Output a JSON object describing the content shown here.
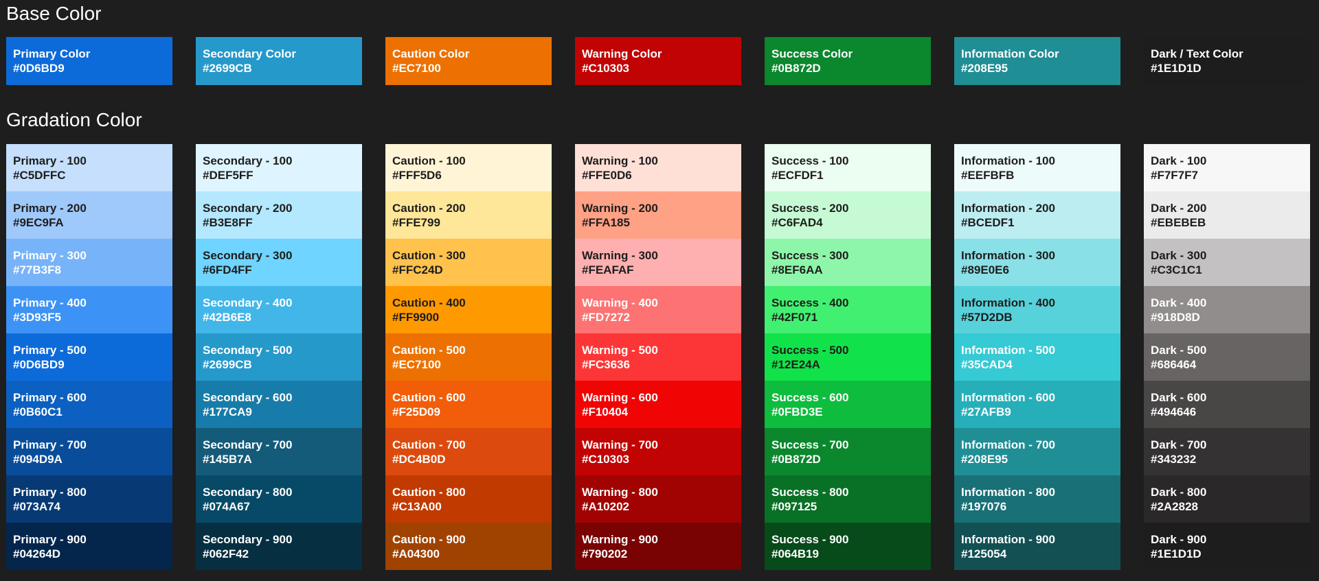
{
  "base": {
    "title": "Base Color",
    "swatches": [
      {
        "name": "Primary Color",
        "hex": "#0D6BD9",
        "bg": "#0D6BD9",
        "fg": "#ffffff"
      },
      {
        "name": "Secondary Color",
        "hex": "#2699CB",
        "bg": "#2699CB",
        "fg": "#ffffff"
      },
      {
        "name": "Caution Color",
        "hex": "#EC7100",
        "bg": "#EC7100",
        "fg": "#ffffff"
      },
      {
        "name": "Warning Color",
        "hex": "#C10303",
        "bg": "#C10303",
        "fg": "#ffffff"
      },
      {
        "name": "Success Color",
        "hex": "#0B872D",
        "bg": "#0B872D",
        "fg": "#ffffff"
      },
      {
        "name": "Information Color",
        "hex": "#208E95",
        "bg": "#208E95",
        "fg": "#ffffff"
      },
      {
        "name": "Dark / Text Color",
        "hex": "#1E1D1D",
        "bg": "#1E1D1D",
        "fg": "#ffffff"
      }
    ]
  },
  "gradation": {
    "title": "Gradation Color",
    "groups": [
      {
        "key": "primary",
        "cells": [
          {
            "label": "Primary - 100",
            "hex": "#C5DFFC",
            "fg": "#1e1d1d"
          },
          {
            "label": "Primary - 200",
            "hex": "#9EC9FA",
            "fg": "#1e1d1d"
          },
          {
            "label": "Primary - 300",
            "hex": "#77B3F8",
            "fg": "#ffffff"
          },
          {
            "label": "Primary - 400",
            "hex": "#3D93F5",
            "fg": "#ffffff"
          },
          {
            "label": "Primary - 500",
            "hex": "#0D6BD9",
            "fg": "#ffffff"
          },
          {
            "label": "Primary - 600",
            "hex": "#0B60C1",
            "fg": "#ffffff"
          },
          {
            "label": "Primary - 700",
            "hex": "#094D9A",
            "fg": "#ffffff"
          },
          {
            "label": "Primary - 800",
            "hex": "#073A74",
            "fg": "#ffffff"
          },
          {
            "label": "Primary - 900",
            "hex": "#04264D",
            "fg": "#ffffff"
          }
        ]
      },
      {
        "key": "secondary",
        "cells": [
          {
            "label": "Secondary - 100",
            "hex": "#DEF5FF",
            "fg": "#1e1d1d"
          },
          {
            "label": "Secondary - 200",
            "hex": "#B3E8FF",
            "fg": "#1e1d1d"
          },
          {
            "label": "Secondary - 300",
            "hex": "#6FD4FF",
            "fg": "#1e1d1d"
          },
          {
            "label": "Secondary - 400",
            "hex": "#42B6E8",
            "fg": "#ffffff"
          },
          {
            "label": "Secondary - 500",
            "hex": "#2699CB",
            "fg": "#ffffff"
          },
          {
            "label": "Secondary - 600",
            "hex": "#177CA9",
            "fg": "#ffffff"
          },
          {
            "label": "Secondary - 700",
            "hex": "#145B7A",
            "fg": "#ffffff"
          },
          {
            "label": "Secondary - 800",
            "hex": "#074A67",
            "fg": "#ffffff"
          },
          {
            "label": "Secondary - 900",
            "hex": "#062F42",
            "fg": "#ffffff"
          }
        ]
      },
      {
        "key": "caution",
        "cells": [
          {
            "label": "Caution - 100",
            "hex": "#FFF5D6",
            "fg": "#1e1d1d"
          },
          {
            "label": "Caution - 200",
            "hex": "#FFE799",
            "fg": "#1e1d1d"
          },
          {
            "label": "Caution - 300",
            "hex": "#FFC24D",
            "fg": "#1e1d1d"
          },
          {
            "label": "Caution - 400",
            "hex": "#FF9900",
            "fg": "#1e1d1d"
          },
          {
            "label": "Caution - 500",
            "hex": "#EC7100",
            "fg": "#ffffff"
          },
          {
            "label": "Caution - 600",
            "hex": "#F25D09",
            "fg": "#ffffff"
          },
          {
            "label": "Caution - 700",
            "hex": "#DC4B0D",
            "fg": "#ffffff"
          },
          {
            "label": "Caution - 800",
            "hex": "#C13A00",
            "fg": "#ffffff"
          },
          {
            "label": "Caution - 900",
            "hex": "#A04300",
            "fg": "#ffffff"
          }
        ]
      },
      {
        "key": "warning",
        "cells": [
          {
            "label": "Warning - 100",
            "hex": "#FFE0D6",
            "fg": "#1e1d1d"
          },
          {
            "label": "Warning - 200",
            "hex": "#FFA185",
            "fg": "#1e1d1d"
          },
          {
            "label": "Warning - 300",
            "hex": "#FEAFAF",
            "fg": "#1e1d1d"
          },
          {
            "label": "Warning - 400",
            "hex": "#FD7272",
            "fg": "#ffffff"
          },
          {
            "label": "Warning - 500",
            "hex": "#FC3636",
            "fg": "#ffffff"
          },
          {
            "label": "Warning - 600",
            "hex": "#F10404",
            "fg": "#ffffff"
          },
          {
            "label": "Warning - 700",
            "hex": "#C10303",
            "fg": "#ffffff"
          },
          {
            "label": "Warning - 800",
            "hex": "#A10202",
            "fg": "#ffffff"
          },
          {
            "label": "Warning - 900",
            "hex": "#790202",
            "fg": "#ffffff"
          }
        ]
      },
      {
        "key": "success",
        "cells": [
          {
            "label": "Success - 100",
            "hex": "#ECFDF1",
            "fg": "#1e1d1d"
          },
          {
            "label": "Success - 200",
            "hex": "#C6FAD4",
            "fg": "#1e1d1d"
          },
          {
            "label": "Success - 300",
            "hex": "#8EF6AA",
            "fg": "#1e1d1d"
          },
          {
            "label": "Success - 400",
            "hex": "#42F071",
            "fg": "#1e1d1d"
          },
          {
            "label": "Success - 500",
            "hex": "#12E24A",
            "fg": "#1e1d1d"
          },
          {
            "label": "Success - 600",
            "hex": "#0FBD3E",
            "fg": "#ffffff"
          },
          {
            "label": "Success - 700",
            "hex": "#0B872D",
            "fg": "#ffffff"
          },
          {
            "label": "Success - 800",
            "hex": "#097125",
            "fg": "#ffffff"
          },
          {
            "label": "Success - 900",
            "hex": "#064B19",
            "fg": "#ffffff"
          }
        ]
      },
      {
        "key": "information",
        "cells": [
          {
            "label": "Information - 100",
            "hex": "#EEFBFB",
            "fg": "#1e1d1d"
          },
          {
            "label": "Information - 200",
            "hex": "#BCEDF1",
            "fg": "#1e1d1d"
          },
          {
            "label": "Information - 300",
            "hex": "#89E0E6",
            "fg": "#1e1d1d"
          },
          {
            "label": "Information - 400",
            "hex": "#57D2DB",
            "fg": "#1e1d1d"
          },
          {
            "label": "Information - 500",
            "hex": "#35CAD4",
            "fg": "#ffffff"
          },
          {
            "label": "Information - 600",
            "hex": "#27AFB9",
            "fg": "#ffffff"
          },
          {
            "label": "Information - 700",
            "hex": "#208E95",
            "fg": "#ffffff"
          },
          {
            "label": "Information - 800",
            "hex": "#197076",
            "fg": "#ffffff"
          },
          {
            "label": "Information - 900",
            "hex": "#125054",
            "fg": "#ffffff"
          }
        ]
      },
      {
        "key": "dark",
        "cells": [
          {
            "label": "Dark - 100",
            "hex": "#F7F7F7",
            "fg": "#1e1d1d"
          },
          {
            "label": "Dark - 200",
            "hex": "#EBEBEB",
            "fg": "#1e1d1d"
          },
          {
            "label": "Dark - 300",
            "hex": "#C3C1C1",
            "fg": "#1e1d1d"
          },
          {
            "label": "Dark - 400",
            "hex": "#918D8D",
            "fg": "#ffffff"
          },
          {
            "label": "Dark - 500",
            "hex": "#686464",
            "fg": "#ffffff"
          },
          {
            "label": "Dark - 600",
            "hex": "#494646",
            "fg": "#ffffff"
          },
          {
            "label": "Dark - 700",
            "hex": "#343232",
            "fg": "#ffffff"
          },
          {
            "label": "Dark - 800",
            "hex": "#2A2828",
            "fg": "#ffffff"
          },
          {
            "label": "Dark - 900",
            "hex": "#1E1D1D",
            "fg": "#ffffff"
          }
        ]
      }
    ]
  }
}
